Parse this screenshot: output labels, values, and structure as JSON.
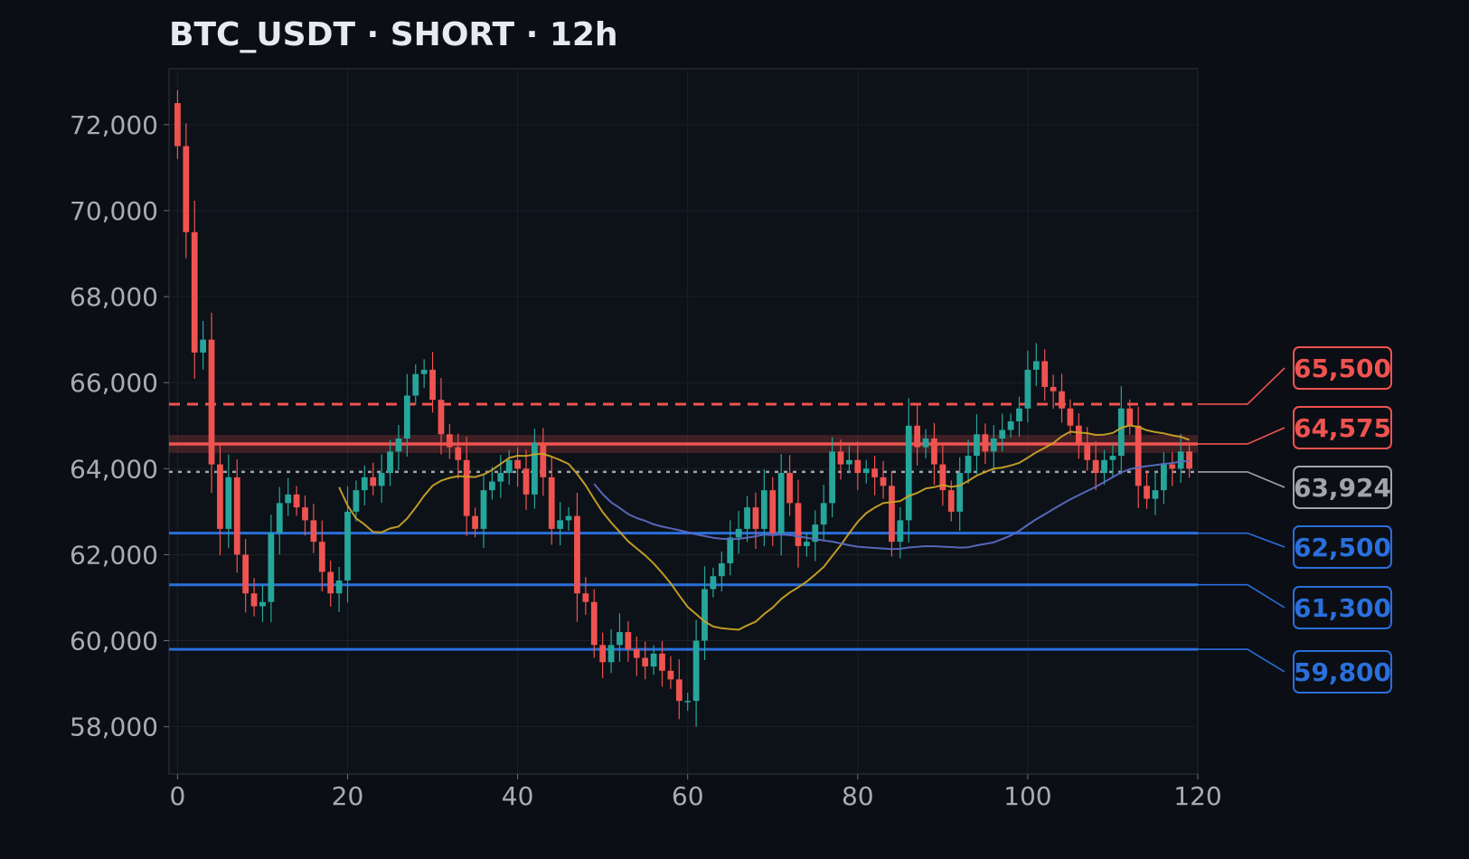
{
  "title": "BTC_USDT · SHORT · 12h",
  "colors": {
    "background": "#0b0e14",
    "plot_background": "#0d1118",
    "up": "#26a69a",
    "down": "#ef5350",
    "ma_fast": "#c9a227",
    "ma_slow": "#5c6bc0",
    "entry": "#ef5350",
    "stop": "#ef5350",
    "current": "#a0a4ab",
    "target": "#2a6fdb"
  },
  "chart_data": {
    "type": "candlestick",
    "title": "BTC_USDT · SHORT · 12h",
    "xlim": [
      -1,
      120
    ],
    "ylim": [
      56900,
      73300
    ],
    "x_ticks": [
      0,
      20,
      40,
      60,
      80,
      100,
      120
    ],
    "y_ticks": [
      58000,
      60000,
      62000,
      64000,
      66000,
      68000,
      70000,
      72000
    ],
    "y_tick_labels": [
      "58,000",
      "60,000",
      "62,000",
      "64,000",
      "66,000",
      "68,000",
      "70,000",
      "72,000"
    ],
    "grid": true,
    "close": [
      71500,
      69500,
      66700,
      67000,
      64100,
      62600,
      63800,
      62000,
      61100,
      60800,
      60900,
      62500,
      63200,
      63400,
      63100,
      62800,
      62300,
      61600,
      61100,
      61400,
      63000,
      63500,
      63800,
      63600,
      63900,
      64400,
      64700,
      65700,
      66200,
      66300,
      65600,
      64800,
      64500,
      64200,
      62900,
      62600,
      63500,
      63700,
      63900,
      64200,
      64000,
      63400,
      64600,
      63800,
      62600,
      62800,
      62900,
      61100,
      60900,
      59900,
      59500,
      59900,
      60200,
      59800,
      59600,
      59400,
      59700,
      59300,
      59100,
      58600,
      58600,
      60000,
      61200,
      61500,
      61800,
      62400,
      62600,
      63100,
      62600,
      63500,
      62500,
      63900,
      63200,
      62200,
      62300,
      62700,
      63200,
      64400,
      64100,
      64200,
      63900,
      64000,
      63800,
      63600,
      62300,
      62800,
      65000,
      64500,
      64700,
      64100,
      63500,
      63000,
      63900,
      64300,
      64800,
      64400,
      64700,
      64900,
      65100,
      65400,
      66300,
      66500,
      65900,
      65800,
      65400,
      65000,
      64600,
      64200,
      63900,
      64200,
      64300,
      65400,
      65000,
      63600,
      63300,
      63500,
      64100,
      64000,
      64400,
      64000
    ],
    "price_lines": [
      {
        "label": "65,500",
        "value": 65500,
        "style": "dashed",
        "role": "stop"
      },
      {
        "label": "64,575",
        "value": 64575,
        "style": "solid-band",
        "role": "entry"
      },
      {
        "label": "63,924",
        "value": 63924,
        "style": "dotted",
        "role": "current"
      },
      {
        "label": "62,500",
        "value": 62500,
        "style": "solid",
        "role": "target"
      },
      {
        "label": "61,300",
        "value": 61300,
        "style": "solid",
        "role": "target"
      },
      {
        "label": "59,800",
        "value": 59800,
        "style": "solid",
        "role": "target"
      }
    ]
  }
}
